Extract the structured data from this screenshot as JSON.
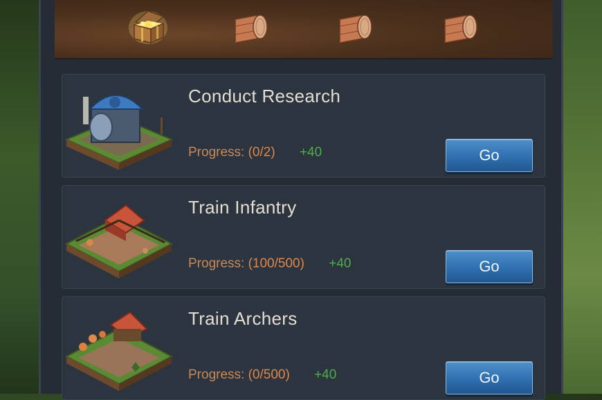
{
  "tasks": [
    {
      "title": "Conduct Research",
      "progress_label": "Progress:",
      "progress_value": "(0/2)",
      "reward": "+40",
      "go_label": "Go",
      "icon": "research-building-icon"
    },
    {
      "title": "Train Infantry",
      "progress_label": "Progress:",
      "progress_value": "(100/500)",
      "reward": "+40",
      "go_label": "Go",
      "icon": "barracks-icon"
    },
    {
      "title": "Train Archers",
      "progress_label": "Progress:",
      "progress_value": "(0/500)",
      "reward": "+40",
      "go_label": "Go",
      "icon": "archery-range-icon"
    }
  ],
  "rewards_bar": {
    "chests": [
      "open-treasure-chest-icon",
      "wooden-chest-icon",
      "wooden-chest-icon",
      "wooden-chest-icon"
    ]
  },
  "colors": {
    "progress_label": "#c98a58",
    "progress_value": "#e0884a",
    "reward": "#4fae4a",
    "go_button": "#2f6fb0",
    "card_bg": "#2c3440"
  }
}
